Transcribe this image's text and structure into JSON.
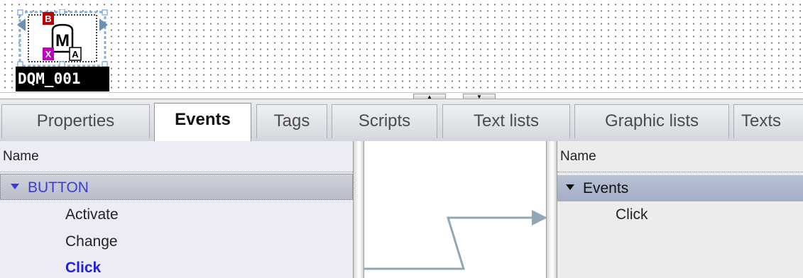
{
  "block": {
    "name": "DQM_001",
    "badges": [
      "B",
      "M",
      "X",
      "A"
    ]
  },
  "splitter": {
    "up_arrow": "▲",
    "down_arrow": "▼"
  },
  "tabs": [
    {
      "label": "Properties"
    },
    {
      "label": "Events"
    },
    {
      "label": "Tags"
    },
    {
      "label": "Scripts"
    },
    {
      "label": "Text lists"
    },
    {
      "label": "Graphic lists"
    },
    {
      "label": "Texts"
    }
  ],
  "active_tab": "Events",
  "left_list": {
    "header": "Name",
    "group": "BUTTON",
    "items": [
      {
        "label": "Activate"
      },
      {
        "label": "Change"
      },
      {
        "label": "Click"
      }
    ],
    "selected": "Click"
  },
  "right_list": {
    "header": "Name",
    "group": "Events",
    "items": [
      {
        "label": "Click"
      }
    ]
  },
  "colors": {
    "left_pane_bg": "#ececf7",
    "group_row_text": "#3b3bdd",
    "selected_text": "#2020e0",
    "connection_line": "#90a8b4",
    "right_group_bg": "#a3aec5"
  }
}
